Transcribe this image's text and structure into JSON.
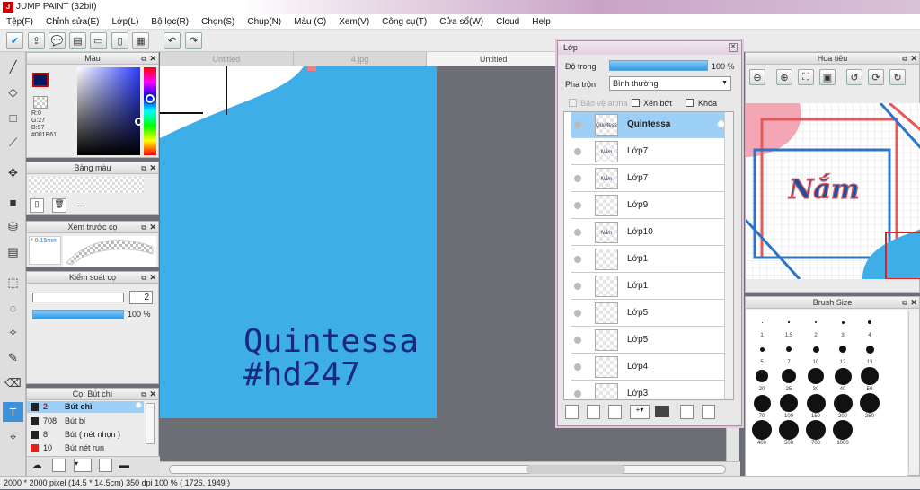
{
  "window": {
    "title": "JUMP PAINT (32bit)"
  },
  "menu": [
    "Tệp(F)",
    "Chỉnh sửa(E)",
    "Lớp(L)",
    "Bộ lọc(R)",
    "Chọn(S)",
    "Chụp(N)",
    "Màu (C)",
    "Xem(V)",
    "Công cụ(T)",
    "Cửa sổ(W)",
    "Cloud",
    "Help"
  ],
  "color_panel": {
    "title": "Màu",
    "r": "R:0",
    "g": "G:27",
    "b": "B:97",
    "hex": "#001B61",
    "fg": "#001b61"
  },
  "swatch_panel": {
    "title": "Bảng màu",
    "placeholder": "---"
  },
  "brush_preview": {
    "title": "Xem trước cọ",
    "size": "0.15mm"
  },
  "brush_control": {
    "title": "Kiểm soát cọ",
    "size": "2",
    "opacity": "100 %"
  },
  "brush_list": {
    "title": "Cọ: Bút chì",
    "items": [
      {
        "num": "2",
        "name": "Bút chì",
        "color": "#222222"
      },
      {
        "num": "708",
        "name": "Bút bi",
        "color": "#222222"
      },
      {
        "num": "8",
        "name": "Bút ( nét nhọn )",
        "color": "#222222"
      },
      {
        "num": "10",
        "name": "Bút nét run",
        "color": "#e02020"
      }
    ]
  },
  "tabs": [
    "Untitled",
    "4.jpg",
    "Untitled"
  ],
  "canvas": {
    "line1": "Quintessa",
    "line2": "#hd247",
    "bg": "#3daee8"
  },
  "layers": {
    "title": "Lớp",
    "opacity_label": "Độ trong",
    "opacity_value": "100 %",
    "blend_label": "Pha trộn",
    "blend_value": "Bình thường",
    "protect_alpha": "Bảo vệ alpha",
    "clip": "Xén bớt",
    "lock": "Khóa",
    "items": [
      {
        "name": "Quintessa",
        "thumb": "Quintessa",
        "selected": true
      },
      {
        "name": "Lớp7",
        "thumb": "Nắm"
      },
      {
        "name": "Lớp7",
        "thumb": "Nắm"
      },
      {
        "name": "Lớp9",
        "thumb": ""
      },
      {
        "name": "Lớp10",
        "thumb": "Nắm"
      },
      {
        "name": "Lớp1",
        "thumb": ""
      },
      {
        "name": "Lớp1",
        "thumb": ""
      },
      {
        "name": "Lớp5",
        "thumb": ""
      },
      {
        "name": "Lớp5",
        "thumb": ""
      },
      {
        "name": "Lớp4",
        "thumb": ""
      },
      {
        "name": "Lớp3",
        "thumb": ""
      }
    ]
  },
  "navigator": {
    "title": "Hoa tiêu",
    "art_text": "Nắm"
  },
  "brush_size": {
    "title": "Brush Size",
    "labels": [
      "1",
      "1.5",
      "2",
      "3",
      "4",
      "5",
      "7",
      "10",
      "12",
      "13",
      "20",
      "25",
      "30",
      "40",
      "50",
      "70",
      "100",
      "150",
      "200",
      "250",
      "400",
      "500",
      "700",
      "1000"
    ]
  },
  "status": {
    "text": "2000 * 2000 pixel   (14.5 * 14.5cm)   350 dpi   100 %   ( 1726, 1949 )"
  }
}
